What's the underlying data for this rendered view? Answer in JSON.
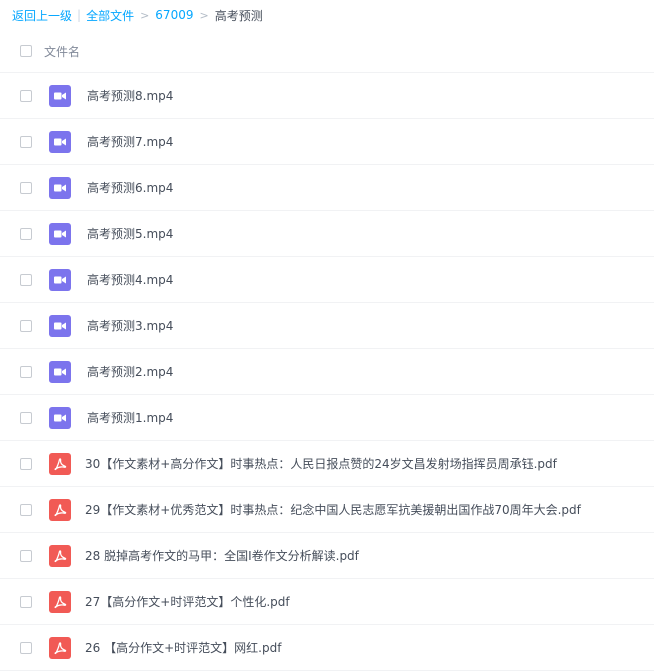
{
  "breadcrumb": {
    "back": "返回上一级",
    "all_files": "全部文件",
    "folder": "67009",
    "current": "高考预测"
  },
  "list_header": {
    "column": "文件名"
  },
  "files": [
    {
      "name": "高考预测8.mp4",
      "type": "video"
    },
    {
      "name": "高考预测7.mp4",
      "type": "video"
    },
    {
      "name": "高考预测6.mp4",
      "type": "video"
    },
    {
      "name": "高考预测5.mp4",
      "type": "video"
    },
    {
      "name": "高考预测4.mp4",
      "type": "video"
    },
    {
      "name": "高考预测3.mp4",
      "type": "video"
    },
    {
      "name": "高考预测2.mp4",
      "type": "video"
    },
    {
      "name": "高考预测1.mp4",
      "type": "video"
    },
    {
      "name": "30【作文素材+高分作文】时事热点：人民日报点赞的24岁文昌发射场指挥员周承钰.pdf",
      "type": "pdf"
    },
    {
      "name": "29【作文素材+优秀范文】时事热点：纪念中国人民志愿军抗美援朝出国作战70周年大会.pdf",
      "type": "pdf"
    },
    {
      "name": "28 脱掉高考作文的马甲：全国I卷作文分析解读.pdf",
      "type": "pdf"
    },
    {
      "name": "27【高分作文+时评范文】个性化.pdf",
      "type": "pdf"
    },
    {
      "name": "26 【高分作文+时评范文】网红.pdf",
      "type": "pdf"
    }
  ],
  "colors": {
    "link": "#06a7ff",
    "video_icon": "#7c74ed",
    "pdf_icon": "#f15a55"
  }
}
